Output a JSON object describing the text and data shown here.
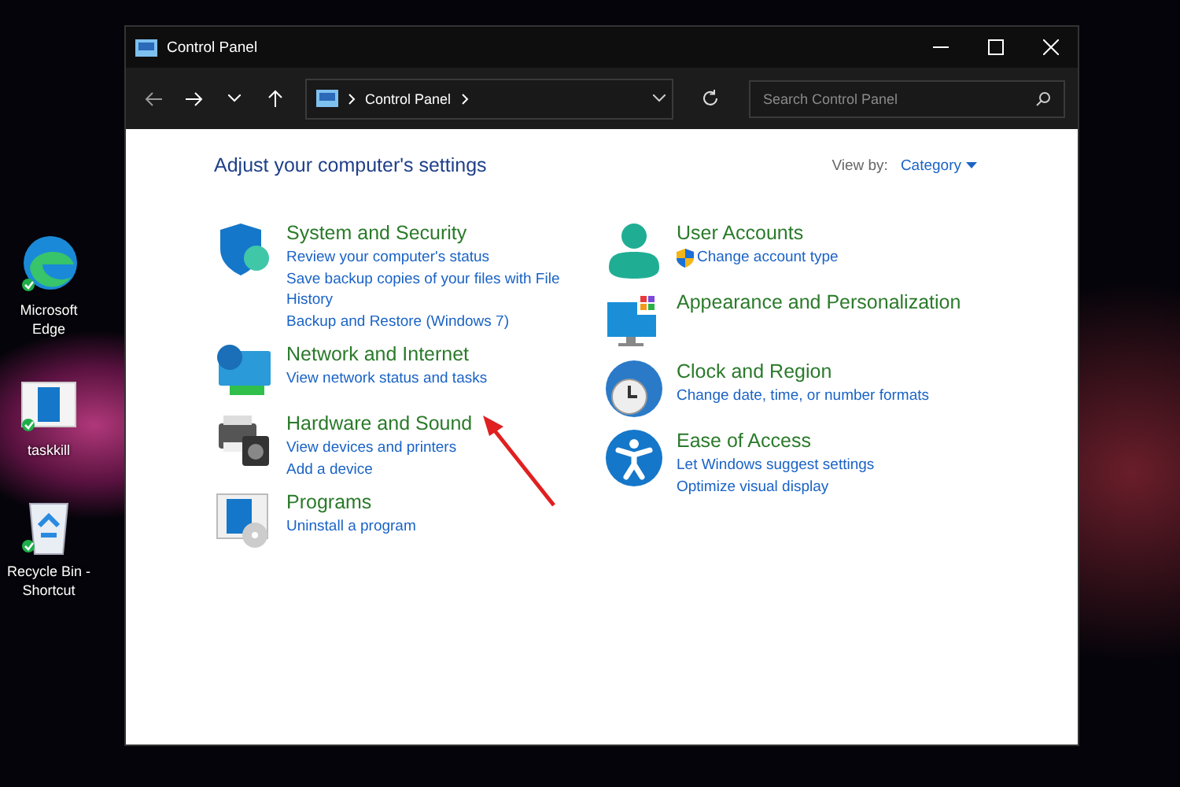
{
  "desktop_icons": [
    {
      "label": "Microsoft Edge"
    },
    {
      "label": "taskkill"
    },
    {
      "label": "Recycle Bin - Shortcut"
    }
  ],
  "window": {
    "title": "Control Panel"
  },
  "address_bar": {
    "path": "Control Panel"
  },
  "search": {
    "placeholder": "Search Control Panel"
  },
  "heading": "Adjust your computer's settings",
  "view_by": {
    "label": "View by:",
    "value": "Category"
  },
  "columns": [
    [
      {
        "title": "System and Security",
        "links": [
          {
            "text": "Review your computer's status",
            "shield": false
          },
          {
            "text": "Save backup copies of your files with File History",
            "shield": false
          },
          {
            "text": "Backup and Restore (Windows 7)",
            "shield": false
          }
        ]
      },
      {
        "title": "Network and Internet",
        "links": [
          {
            "text": "View network status and tasks",
            "shield": false
          }
        ]
      },
      {
        "title": "Hardware and Sound",
        "links": [
          {
            "text": "View devices and printers",
            "shield": false
          },
          {
            "text": "Add a device",
            "shield": false
          }
        ]
      },
      {
        "title": "Programs",
        "links": [
          {
            "text": "Uninstall a program",
            "shield": false
          }
        ]
      }
    ],
    [
      {
        "title": "User Accounts",
        "links": [
          {
            "text": "Change account type",
            "shield": true
          }
        ]
      },
      {
        "title": "Appearance and Personalization"
      },
      {
        "title": "Clock and Region",
        "links": [
          {
            "text": "Change date, time, or number formats",
            "shield": false
          }
        ]
      },
      {
        "title": "Ease of Access",
        "links": [
          {
            "text": "Let Windows suggest settings",
            "shield": false
          },
          {
            "text": "Optimize visual display",
            "shield": false
          }
        ]
      }
    ]
  ]
}
